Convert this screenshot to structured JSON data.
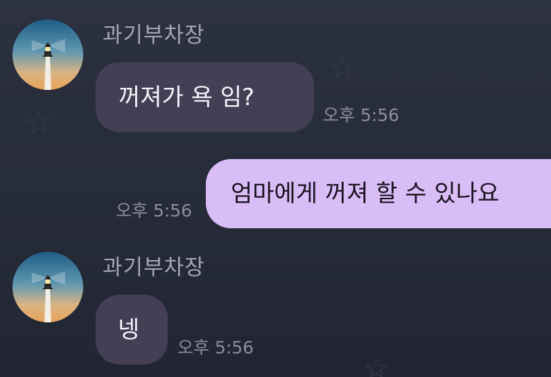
{
  "messages": [
    {
      "type": "incoming",
      "sender": "과기부차장",
      "text": "꺼져가 욕 임?",
      "time": "오후 5:56"
    },
    {
      "type": "outgoing",
      "text": "엄마에게 꺼져 할 수 있나요",
      "time": "오후 5:56"
    },
    {
      "type": "incoming",
      "sender": "과기부차장",
      "text": "넹",
      "time": "오후 5:56"
    }
  ],
  "avatar_icon": "lighthouse-avatar",
  "colors": {
    "background": "#2a2f3d",
    "incoming_bubble": "#443f55",
    "outgoing_bubble": "#d9bdf6",
    "timestamp": "#8a8e9a",
    "sender_name": "#a3a7b3"
  }
}
